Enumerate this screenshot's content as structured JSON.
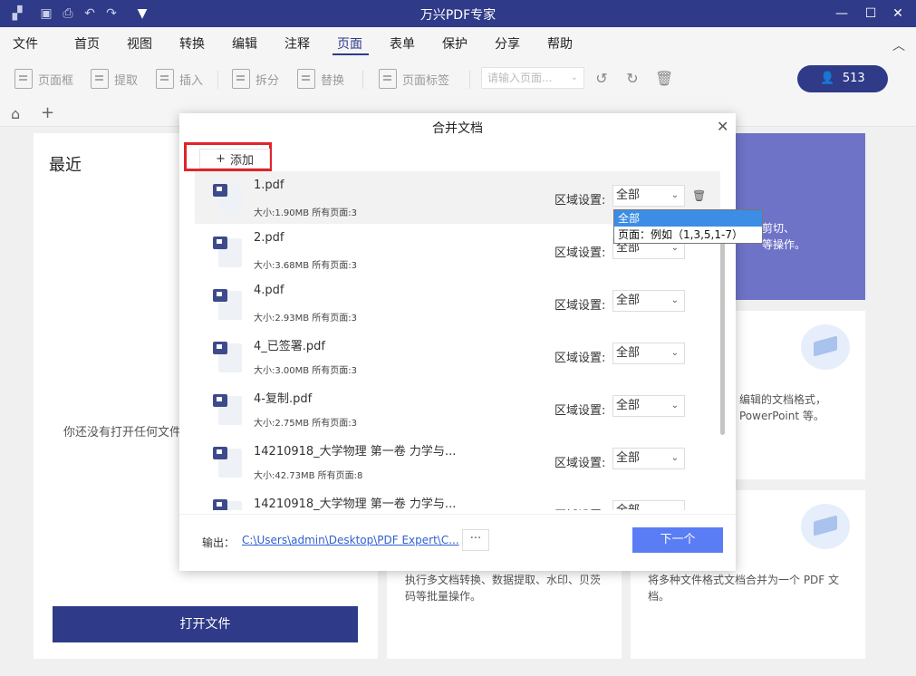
{
  "app": {
    "title": "万兴PDF专家"
  },
  "menu": [
    "文件",
    "首页",
    "视图",
    "转换",
    "编辑",
    "注释",
    "页面",
    "表单",
    "保护",
    "分享",
    "帮助"
  ],
  "toolbar": {
    "page_box": "页面框",
    "extract": "提取",
    "insert": "插入",
    "split": "拆分",
    "replace": "替换",
    "page_label": "页面标签",
    "page_input_placeholder": "请输入页面...",
    "user_count": "513"
  },
  "recent": {
    "title": "最近",
    "empty_text": "你还没有打开任何文件，",
    "open_button": "打开文件"
  },
  "cards": {
    "purple_line1": "剪切、",
    "purple_line2": "等操作。",
    "convert_line1": "编辑的文档格式，",
    "convert_line2": "PowerPoint 等。",
    "batch_line1": "执行多文档转换、数据提取、水印、贝茨",
    "batch_line2": "码等批量操作。",
    "combine_line1": "将多种文件格式文档合并为一个 PDF 文",
    "combine_line2": "档。"
  },
  "modal": {
    "title": "合并文档",
    "add_button": "添加",
    "region_label": "区域设置:",
    "files": [
      {
        "name": "1.pdf",
        "meta": "大小:1.90MB   所有页面:3",
        "region": "全部"
      },
      {
        "name": "2.pdf",
        "meta": "大小:3.68MB   所有页面:3",
        "region": "全部"
      },
      {
        "name": "4.pdf",
        "meta": "大小:2.93MB   所有页面:3",
        "region": "全部"
      },
      {
        "name": "4_已签署.pdf",
        "meta": "大小:3.00MB   所有页面:3",
        "region": "全部"
      },
      {
        "name": "4-复制.pdf",
        "meta": "大小:2.75MB   所有页面:3",
        "region": "全部"
      },
      {
        "name": "14210918_大学物理 第一卷 力学与...",
        "meta": "大小:42.73MB   所有页面:8",
        "region": "全部"
      },
      {
        "name": "14210918_大学物理 第一卷 力学与...",
        "meta": "",
        "region": "全部"
      }
    ],
    "dropdown_options": [
      "全部",
      "页面：例如（1,3,5,1-7）"
    ],
    "output_label": "输出：",
    "output_path": "C:\\Users\\admin\\Desktop\\PDF Expert\\C...",
    "more_button": "···",
    "next_button": "下一个"
  }
}
